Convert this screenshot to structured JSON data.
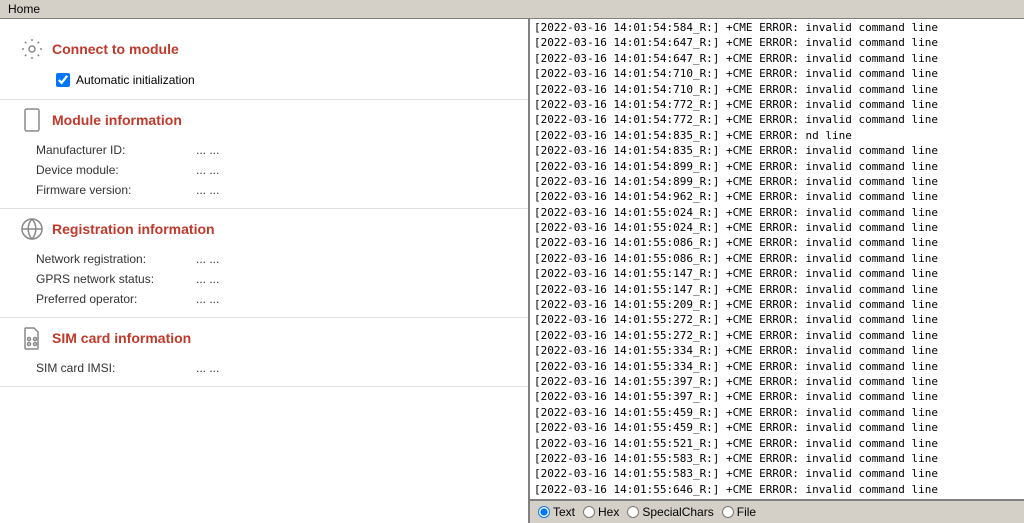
{
  "menubar": {
    "items": [
      "Home"
    ]
  },
  "left_panel": {
    "sections": [
      {
        "id": "connect",
        "icon": "gear",
        "title": "Connect to module",
        "sub_items": [
          {
            "type": "checkbox",
            "label": "Automatic initialization",
            "checked": true
          }
        ],
        "fields": []
      },
      {
        "id": "module",
        "icon": "phone",
        "title": "Module information",
        "sub_items": [],
        "fields": [
          {
            "label": "Manufacturer ID:",
            "value": "... ..."
          },
          {
            "label": "Device module:",
            "value": "... ..."
          },
          {
            "label": "Firmware version:",
            "value": "... ..."
          }
        ]
      },
      {
        "id": "registration",
        "icon": "network",
        "title": "Registration information",
        "sub_items": [],
        "fields": [
          {
            "label": "Network registration:",
            "value": "... ..."
          },
          {
            "label": "GPRS network status:",
            "value": "... ..."
          },
          {
            "label": "Preferred operator:",
            "value": "... ..."
          }
        ]
      },
      {
        "id": "sim",
        "icon": "sim",
        "title": "SIM card information",
        "sub_items": [],
        "fields": [
          {
            "label": "SIM card IMSI:",
            "value": "... ..."
          }
        ]
      }
    ]
  },
  "log": {
    "lines": [
      "[2022-03-16 14:01:54:584_R:] +CME ERROR: invalid command line",
      "[2022-03-16 14:01:54:647_R:] +CME ERROR: invalid command line",
      "[2022-03-16 14:01:54:647_R:] +CME ERROR: invalid command line",
      "[2022-03-16 14:01:54:710_R:] +CME ERROR: invalid command line",
      "[2022-03-16 14:01:54:710_R:] +CME ERROR: invalid command line",
      "[2022-03-16 14:01:54:772_R:] +CME ERROR: invalid command line",
      "[2022-03-16 14:01:54:772_R:] +CME ERROR: invalid command line",
      "[2022-03-16 14:01:54:835_R:] +CME ERROR: nd line",
      "[2022-03-16 14:01:54:835_R:] +CME ERROR: invalid command line",
      "[2022-03-16 14:01:54:899_R:] +CME ERROR: invalid command line",
      "[2022-03-16 14:01:54:899_R:] +CME ERROR: invalid command line",
      "[2022-03-16 14:01:54:962_R:] +CME ERROR: invalid command line",
      "[2022-03-16 14:01:55:024_R:] +CME ERROR: invalid command line",
      "[2022-03-16 14:01:55:024_R:] +CME ERROR: invalid command line",
      "[2022-03-16 14:01:55:086_R:] +CME ERROR: invalid command line",
      "[2022-03-16 14:01:55:086_R:] +CME ERROR: invalid command line",
      "[2022-03-16 14:01:55:147_R:] +CME ERROR: invalid command line",
      "[2022-03-16 14:01:55:147_R:] +CME ERROR: invalid command line",
      "[2022-03-16 14:01:55:209_R:] +CME ERROR: invalid command line",
      "[2022-03-16 14:01:55:272_R:] +CME ERROR: invalid command line",
      "[2022-03-16 14:01:55:272_R:] +CME ERROR: invalid command line",
      "[2022-03-16 14:01:55:334_R:] +CME ERROR: invalid command line",
      "[2022-03-16 14:01:55:334_R:] +CME ERROR: invalid command line",
      "[2022-03-16 14:01:55:397_R:] +CME ERROR: invalid command line",
      "[2022-03-16 14:01:55:397_R:] +CME ERROR: invalid command line",
      "[2022-03-16 14:01:55:459_R:] +CME ERROR: invalid command line",
      "[2022-03-16 14:01:55:459_R:] +CME ERROR: invalid command line",
      "[2022-03-16 14:01:55:521_R:] +CME ERROR: invalid command line",
      "[2022-03-16 14:01:55:583_R:] +CME ERROR: invalid command line",
      "[2022-03-16 14:01:55:583_R:] +CME ERROR: invalid command line",
      "[2022-03-16 14:01:55:646_R:] +CME ERROR: invalid command line"
    ]
  },
  "bottom_toolbar": {
    "radio_options": [
      {
        "id": "text",
        "label": "Text",
        "selected": true
      },
      {
        "id": "hex",
        "label": "Hex",
        "selected": false
      },
      {
        "id": "specialchars",
        "label": "SpecialChars",
        "selected": false
      },
      {
        "id": "file",
        "label": "File",
        "selected": false
      }
    ]
  }
}
